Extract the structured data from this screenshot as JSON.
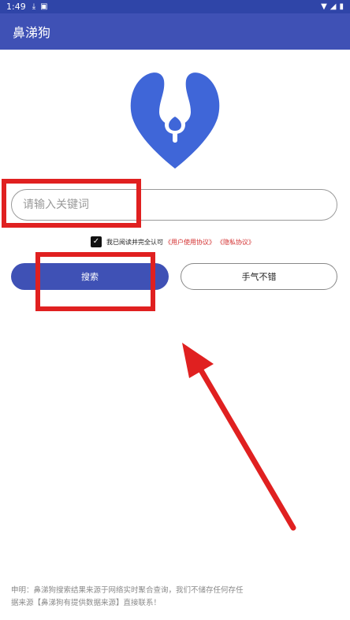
{
  "status_bar": {
    "time": "1:49",
    "icons": [
      "download-icon",
      "notification-icon",
      "wifi-icon",
      "signal-icon",
      "battery-icon"
    ]
  },
  "app_bar": {
    "title": "鼻涕狗"
  },
  "logo": {
    "name": "nose-drop-logo",
    "color": "#3f66d8"
  },
  "search": {
    "placeholder": "请输入关键词",
    "value": ""
  },
  "agreement": {
    "checked": true,
    "text": "我已阅读并完全认可",
    "user_agreement": "《用户使用协议》",
    "privacy_policy": "《隐私协议》"
  },
  "buttons": {
    "search": "搜索",
    "lucky": "手气不错"
  },
  "disclaimer": {
    "line1": "申明：鼻涕狗搜索结果来源于网络实时聚合查询，我们不储存任何存任",
    "line2": "据来源【鼻涕狗有提供数据来源】直接联系！"
  },
  "colors": {
    "primary": "#3f51b5",
    "status_bar": "#2f45a8",
    "annotation": "#e02020",
    "link": "#d32f2f"
  }
}
